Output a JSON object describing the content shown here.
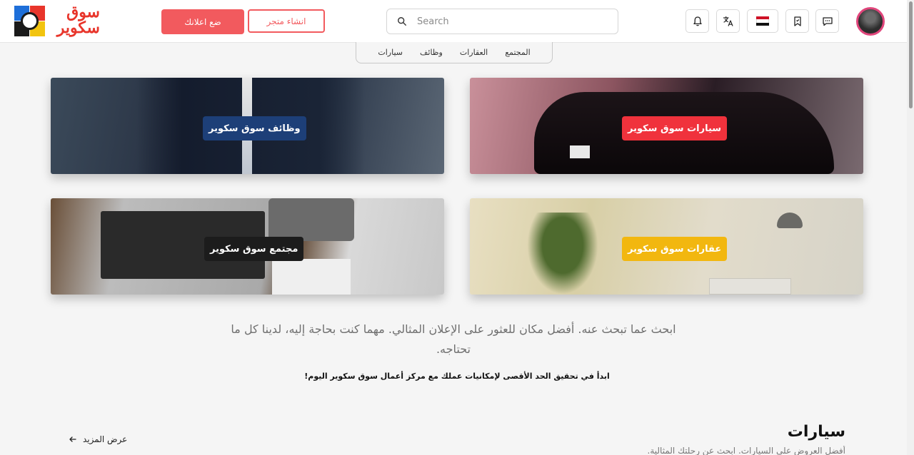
{
  "header": {
    "logo_line1": "سوق",
    "logo_line2": "سكوير",
    "post_ad_label": "ضع اعلانك",
    "create_store_label": "انشاء متجر",
    "search_placeholder": "Search"
  },
  "category_nav": [
    "المجتمع",
    "العقارات",
    "وظائف",
    "سيارات"
  ],
  "cards": {
    "cars": "سيارات سوق سكوير",
    "jobs": "وظائف سوق سكوير",
    "realestate": "عقارات سوق سكوير",
    "community": "مجتمع سوق سكوير"
  },
  "tagline": "ابحث عما تبحث عنه. أفضل مكان للعثور على الإعلان المثالي. مهما كنت بحاجة إليه، لدينا كل ما تحتاجه.",
  "subline": "ابدأ في تحقيق الحد الأقصى لإمكانيات عملك مع مركز أعمال سوق سكوير اليوم!",
  "section": {
    "title": "سيارات",
    "subtitle": "أفضل العروض على السيارات. ابحث عن رحلتك المثالية.",
    "more_label": "عرض المزيد"
  },
  "colors": {
    "accent": "#f25a5e",
    "cars_badge": "#f0323c",
    "jobs_badge": "#1d3f78",
    "realestate_badge": "#f2b70f",
    "community_badge": "#1c1c1c"
  },
  "icons": {
    "search": "search-icon",
    "notifications": "bell-icon",
    "language": "translate-icon",
    "country": "egypt-flag-icon",
    "saved": "bookmark-icon",
    "messages": "chat-icon",
    "more": "arrow-left-icon"
  }
}
